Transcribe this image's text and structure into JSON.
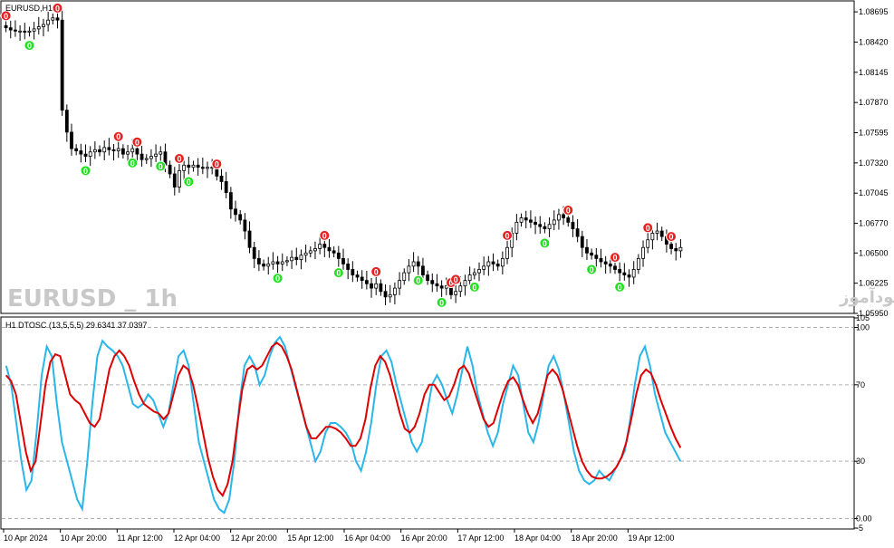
{
  "main_panel": {
    "title": "EURUSD,H1",
    "watermark_left": "EURUSD _ 1h",
    "watermark_right": "انتشار در سایت سودآموز",
    "price_labels": [
      "1.08695",
      "1.08420",
      "1.08145",
      "1.07870",
      "1.07595",
      "1.07320",
      "1.07045",
      "1.06770",
      "1.06500",
      "1.06225",
      "1.05950"
    ]
  },
  "indicator_panel": {
    "title": "H1 DTOSC (13,5,5,5) 29.6341 37.0397",
    "scale_labels": [
      "105",
      "100",
      "70",
      "30",
      "0.00",
      "-5"
    ],
    "fast_line_color": "#29b6e8",
    "slow_line_color": "#dd0000"
  },
  "time_axis": {
    "labels": [
      "10 Apr 2024",
      "10 Apr 20:00",
      "11 Apr 12:00",
      "12 Apr 04:00",
      "12 Apr 20:00",
      "15 Apr 12:00",
      "16 Apr 04:00",
      "16 Apr 20:00",
      "17 Apr 12:00",
      "18 Apr 04:00",
      "18 Apr 20:00",
      "19 Apr 12:00"
    ]
  },
  "chart_data": {
    "type": "candlestick",
    "symbol": "EURUSD",
    "timeframe": "H1",
    "price_range": [
      1.0595,
      1.0877
    ],
    "close_series": [
      1.0855,
      1.0853,
      1.0852,
      1.0852,
      1.0851,
      1.0852,
      1.0854,
      1.0856,
      1.0858,
      1.0862,
      1.0864,
      1.0862,
      1.078,
      1.076,
      1.0745,
      1.0743,
      1.074,
      1.0738,
      1.0742,
      1.0744,
      1.0742,
      1.0746,
      1.0744,
      1.0743,
      1.0745,
      1.074,
      1.0742,
      1.0745,
      1.074,
      1.0735,
      1.0736,
      1.0738,
      1.074,
      1.0742,
      1.073,
      1.0722,
      1.071,
      1.0725,
      1.073,
      1.0728,
      1.073,
      1.0728,
      1.0727,
      1.0728,
      1.0728,
      1.072,
      1.0715,
      1.0705,
      1.069,
      1.0685,
      1.068,
      1.067,
      1.0655,
      1.0645,
      1.064,
      1.0638,
      1.064,
      1.0642,
      1.064,
      1.0642,
      1.0643,
      1.0646,
      1.0644,
      1.0648,
      1.065,
      1.0652,
      1.0654,
      1.0658,
      1.0655,
      1.0652,
      1.065,
      1.0645,
      1.064,
      1.0635,
      1.063,
      1.0628,
      1.0625,
      1.0622,
      1.0618,
      1.0622,
      1.0615,
      1.061,
      1.0612,
      1.0618,
      1.0625,
      1.0632,
      1.0638,
      1.0642,
      1.0638,
      1.063,
      1.0625,
      1.0622,
      1.062,
      1.0618,
      1.062,
      1.0612,
      1.0615,
      1.062,
      1.0625,
      1.063,
      1.0632,
      1.0635,
      1.0638,
      1.0642,
      1.064,
      1.0638,
      1.0645,
      1.0655,
      1.0668,
      1.0678,
      1.0682,
      1.068,
      1.0678,
      1.0676,
      1.0674,
      1.0672,
      1.0676,
      1.068,
      1.0685,
      1.0682,
      1.0678,
      1.0672,
      1.0665,
      1.0655,
      1.065,
      1.0648,
      1.0645,
      1.0642,
      1.064,
      1.0638,
      1.0635,
      1.0632,
      1.063,
      1.0628,
      1.0635,
      1.0645,
      1.0655,
      1.0662,
      1.0668,
      1.067,
      1.0665,
      1.0658,
      1.0654,
      1.0652,
      1.0655
    ],
    "signals": [
      {
        "type": "sell",
        "label": "0",
        "index": 0
      },
      {
        "type": "buy",
        "label": "0",
        "index": 5
      },
      {
        "type": "sell",
        "label": "0",
        "index": 11
      },
      {
        "type": "buy",
        "label": "0",
        "index": 17
      },
      {
        "type": "sell",
        "label": "0",
        "index": 24
      },
      {
        "type": "sell",
        "label": "0",
        "index": 28
      },
      {
        "type": "buy",
        "label": "0",
        "index": 27
      },
      {
        "type": "buy",
        "label": "0",
        "index": 33
      },
      {
        "type": "sell",
        "label": "0",
        "index": 37
      },
      {
        "type": "buy",
        "label": "0",
        "index": 39
      },
      {
        "type": "sell",
        "label": "0",
        "index": 45
      },
      {
        "type": "buy",
        "label": "0",
        "index": 58
      },
      {
        "type": "sell",
        "label": "0",
        "index": 68
      },
      {
        "type": "buy",
        "label": "0",
        "index": 71
      },
      {
        "type": "sell",
        "label": "0",
        "index": 79
      },
      {
        "type": "buy",
        "label": "0",
        "index": 88
      },
      {
        "type": "sell",
        "label": "0",
        "index": 95
      },
      {
        "type": "buy",
        "label": "0",
        "index": 93
      },
      {
        "type": "sell",
        "label": "0",
        "index": 96
      },
      {
        "type": "buy",
        "label": "0",
        "index": 100
      },
      {
        "type": "sell",
        "label": "0",
        "index": 107
      },
      {
        "type": "buy",
        "label": "0",
        "index": 115
      },
      {
        "type": "sell",
        "label": "0",
        "index": 120
      },
      {
        "type": "buy",
        "label": "0",
        "index": 125
      },
      {
        "type": "sell",
        "label": "0",
        "index": 130
      },
      {
        "type": "buy",
        "label": "0",
        "index": 131
      },
      {
        "type": "sell",
        "label": "0",
        "index": 137
      },
      {
        "type": "sell",
        "label": "0",
        "index": 142
      },
      {
        "type": "buy",
        "label": "0",
        "index": 148
      },
      {
        "type": "sell",
        "label": "0",
        "index": 151
      },
      {
        "type": "buy",
        "label": "0",
        "index": 149
      }
    ],
    "oscillator": {
      "name": "DTOSC",
      "fast_value": 29.6341,
      "slow_value": 37.0397,
      "levels": [
        0,
        30,
        70,
        100
      ],
      "range": [
        -5,
        105
      ],
      "fast": [
        80,
        70,
        50,
        30,
        15,
        20,
        45,
        75,
        90,
        85,
        60,
        40,
        30,
        20,
        10,
        5,
        30,
        60,
        85,
        93,
        90,
        88,
        85,
        80,
        70,
        60,
        58,
        60,
        65,
        62,
        55,
        48,
        55,
        70,
        85,
        88,
        80,
        60,
        40,
        30,
        20,
        10,
        5,
        3,
        10,
        30,
        60,
        80,
        85,
        80,
        70,
        75,
        85,
        92,
        95,
        90,
        80,
        70,
        60,
        50,
        40,
        30,
        35,
        45,
        50,
        50,
        48,
        45,
        40,
        30,
        25,
        35,
        50,
        70,
        85,
        88,
        82,
        70,
        60,
        50,
        40,
        35,
        40,
        55,
        70,
        75,
        70,
        62,
        55,
        65,
        78,
        90,
        80,
        65,
        55,
        45,
        38,
        45,
        60,
        70,
        80,
        75,
        60,
        45,
        40,
        50,
        65,
        80,
        85,
        78,
        65,
        50,
        35,
        25,
        20,
        18,
        20,
        25,
        22,
        20,
        25,
        30,
        35,
        50,
        70,
        85,
        90,
        80,
        65,
        55,
        45,
        40,
        35,
        30
      ],
      "slow": [
        75,
        72,
        65,
        50,
        35,
        25,
        30,
        50,
        70,
        82,
        86,
        85,
        75,
        65,
        62,
        60,
        55,
        50,
        48,
        52,
        65,
        78,
        85,
        88,
        85,
        80,
        72,
        65,
        60,
        58,
        56,
        55,
        52,
        55,
        65,
        75,
        80,
        78,
        70,
        58,
        45,
        32,
        22,
        15,
        12,
        18,
        30,
        50,
        68,
        78,
        80,
        78,
        80,
        85,
        90,
        92,
        90,
        85,
        78,
        68,
        58,
        48,
        42,
        42,
        45,
        48,
        48,
        47,
        45,
        42,
        38,
        38,
        42,
        52,
        68,
        80,
        85,
        82,
        75,
        65,
        55,
        47,
        45,
        48,
        55,
        65,
        70,
        70,
        66,
        62,
        64,
        70,
        78,
        80,
        76,
        68,
        60,
        52,
        48,
        50,
        58,
        66,
        72,
        74,
        70,
        62,
        55,
        50,
        55,
        65,
        75,
        78,
        75,
        68,
        58,
        48,
        38,
        30,
        25,
        22,
        21,
        21,
        22,
        24,
        27,
        32,
        40,
        52,
        65,
        75,
        78,
        76,
        70,
        62,
        55,
        48,
        42,
        37
      ]
    }
  }
}
